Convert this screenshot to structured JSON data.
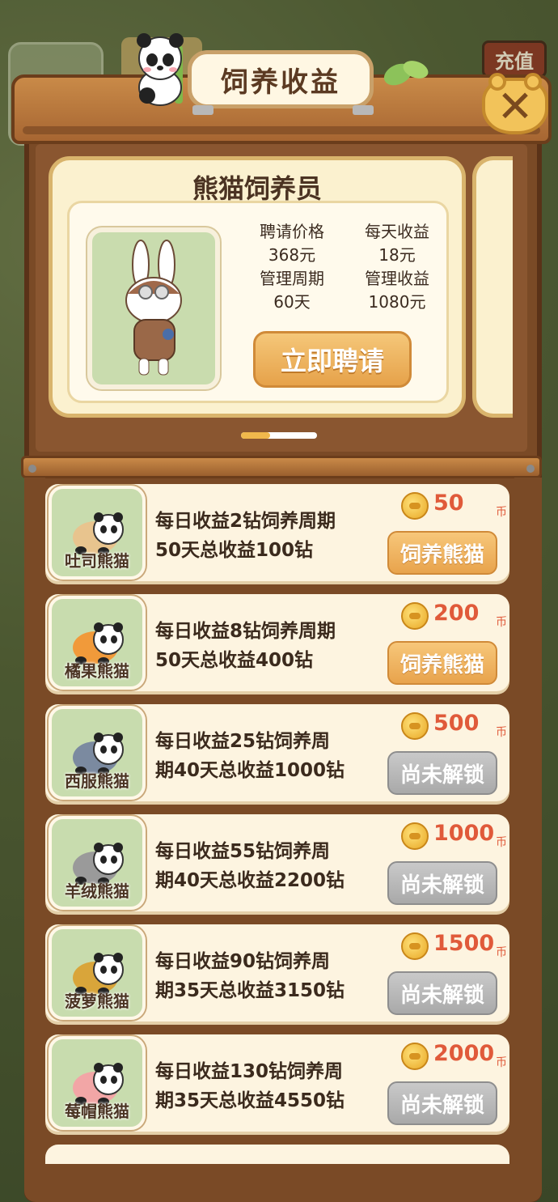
{
  "header": {
    "title": "饲养收益",
    "recharge_label": "充值",
    "close_label": "✕"
  },
  "keeper_card": {
    "title": "熊猫饲养员",
    "hire_price_label": "聘请价格",
    "hire_price_value": "368元",
    "daily_income_label": "每天收益",
    "daily_income_value": "18元",
    "manage_period_label": "管理周期",
    "manage_period_value": "60天",
    "manage_income_label": "管理收益",
    "manage_income_value": "1080元",
    "hire_button": "立即聘请"
  },
  "pandas": [
    {
      "name": "吐司熊猫",
      "line1": "每日收益2钻饲养周期",
      "line2": "50天总收益100钻",
      "price": "50",
      "unit": "币",
      "button": "饲养熊猫",
      "state": "on",
      "color": "#e8c48e"
    },
    {
      "name": "橘果熊猫",
      "line1": "每日收益8钻饲养周期",
      "line2": "50天总收益400钻",
      "price": "200",
      "unit": "币",
      "button": "饲养熊猫",
      "state": "on",
      "color": "#f19a3a"
    },
    {
      "name": "西服熊猫",
      "line1": "每日收益25钻饲养周",
      "line2": "期40天总收益1000钻",
      "price": "500",
      "unit": "币",
      "button": "尚未解锁",
      "state": "off",
      "color": "#7b8aa0"
    },
    {
      "name": "羊绒熊猫",
      "line1": "每日收益55钻饲养周",
      "line2": "期40天总收益2200钻",
      "price": "1000",
      "unit": "币",
      "button": "尚未解锁",
      "state": "off",
      "color": "#9a9a9a"
    },
    {
      "name": "菠萝熊猫",
      "line1": "每日收益90钻饲养周",
      "line2": "期35天总收益3150钻",
      "price": "1500",
      "unit": "币",
      "button": "尚未解锁",
      "state": "off",
      "color": "#d9a53a"
    },
    {
      "name": "莓帽熊猫",
      "line1": "每日收益130钻饲养周",
      "line2": "期35天总收益4550钻",
      "price": "2000",
      "unit": "币",
      "button": "尚未解锁",
      "state": "off",
      "color": "#f2a6a6"
    }
  ]
}
